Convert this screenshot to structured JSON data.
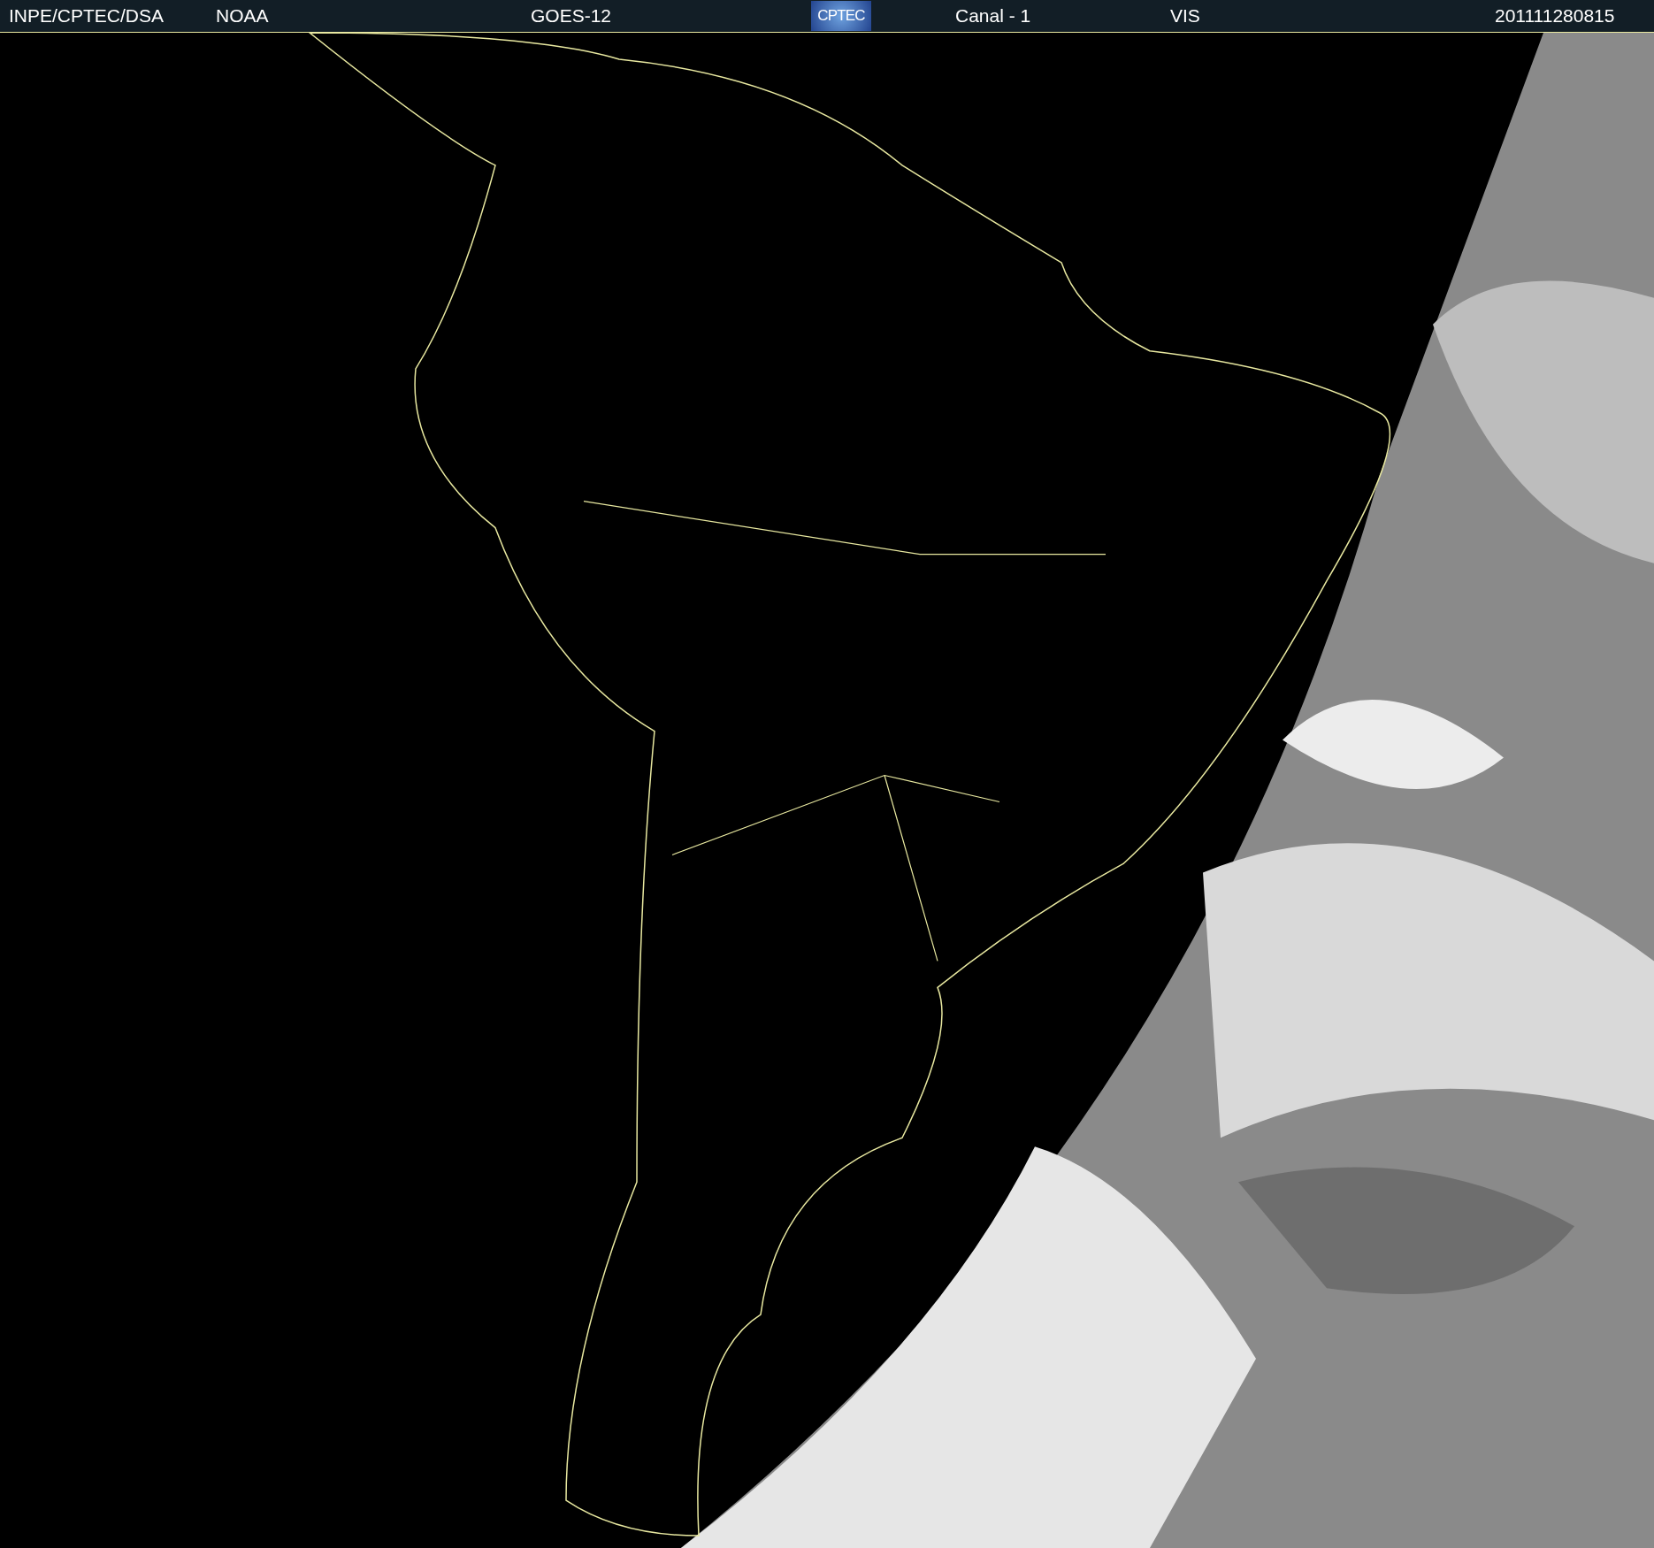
{
  "header": {
    "source": "INPE/CPTEC/DSA",
    "agency": "NOAA",
    "satellite": "GOES-12",
    "logo": "CPTEC",
    "channel": "Canal - 1",
    "band": "VIS",
    "timestamp": "201111280815"
  }
}
